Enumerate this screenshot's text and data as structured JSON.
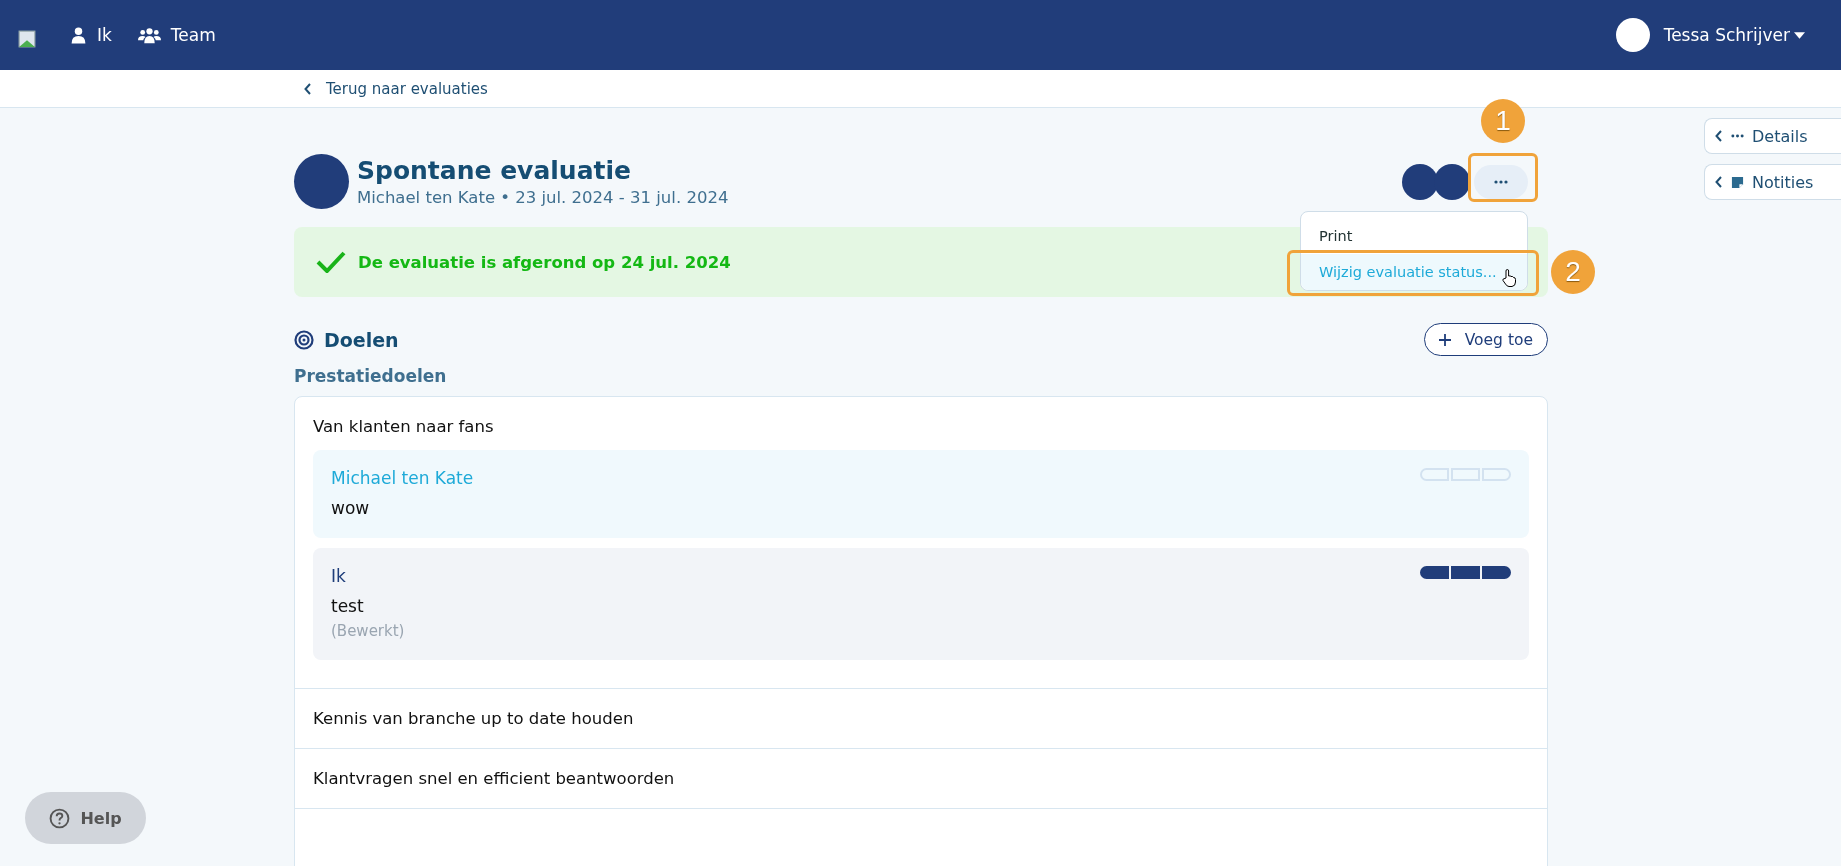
{
  "nav": {
    "items": [
      {
        "label": "Ik",
        "kind": "person"
      },
      {
        "label": "Team",
        "kind": "group"
      }
    ],
    "user": "Tessa Schrijver"
  },
  "back_link": "Terug naar evaluaties",
  "side_tabs": [
    {
      "label": "Details",
      "kind": "dots"
    },
    {
      "label": "Notities",
      "kind": "note"
    }
  ],
  "header": {
    "title": "Spontane evaluatie",
    "subtitle": "Michael ten Kate • 23 jul. 2024 - 31 jul. 2024"
  },
  "more_button": {
    "annotation": "1"
  },
  "menu": {
    "open": true,
    "items": [
      {
        "label": "Print",
        "selected": false
      },
      {
        "label": "Wijzig evaluatie status...",
        "selected": true,
        "annotation": "2"
      }
    ]
  },
  "banner": "De evaluatie is afgerond op 24 jul. 2024",
  "goals": {
    "title": "Doelen",
    "add_button": "Voeg toe",
    "section": "Prestatiedoelen",
    "items": [
      {
        "title": "Van klanten naar fans",
        "expanded": true,
        "reviews": [
          {
            "author": "Michael ten Kate",
            "text": "wow",
            "kind": "other",
            "stars": 0
          },
          {
            "author": "Ik",
            "text": "test",
            "note": "(Bewerkt)",
            "kind": "own",
            "stars": 3
          }
        ]
      },
      {
        "title": "Kennis van branche up to date houden",
        "expanded": false
      },
      {
        "title": "Klantvragen snel en efficient beantwoorden",
        "expanded": false
      }
    ]
  },
  "help": "Help"
}
